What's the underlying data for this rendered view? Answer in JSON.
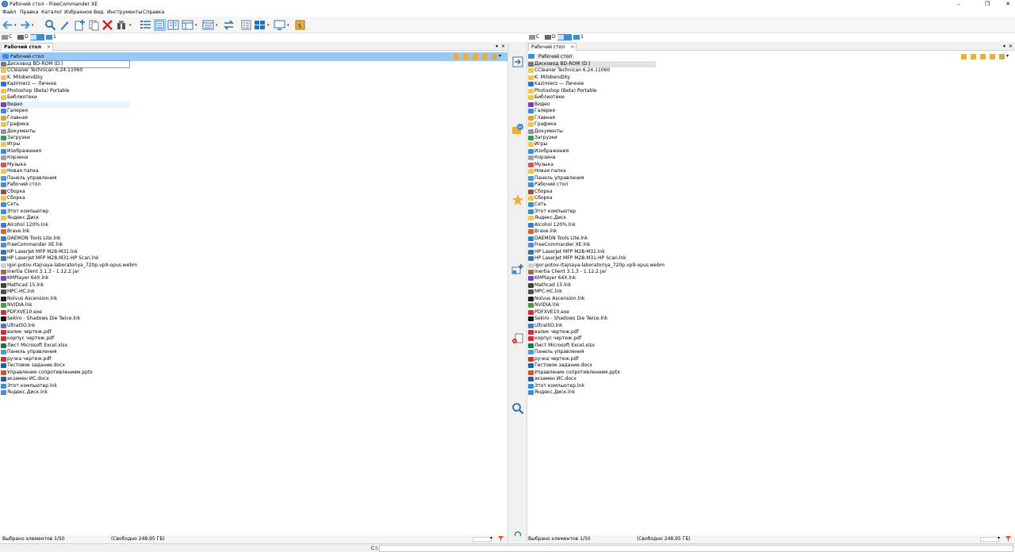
{
  "window": {
    "title": "Рабочий стол - FreeCommander XE"
  },
  "menu": [
    "Файл",
    "Правка",
    "Каталог",
    "Избранное",
    "Вид",
    "Инструменты",
    "Справка"
  ],
  "drives": [
    {
      "label": "C",
      "icon": "drive-icon"
    },
    {
      "label": "D",
      "icon": "optical-drive-icon"
    },
    {
      "label": "",
      "icon": "desktop-drive-icon"
    },
    {
      "label": "1",
      "icon": "network-drive-icon"
    }
  ],
  "left": {
    "tab": "Рабочий стол",
    "path": "Рабочий стол",
    "status_selected": "Выбрано элементов 1/50",
    "status_free": "(Свободно 248,95 ГБ)"
  },
  "right": {
    "tab": "Рабочий стол",
    "path": "Рабочий стол",
    "status_selected": "Выбрано элементов 1/50",
    "status_free": "(Свободно 248,95 ГБ)"
  },
  "files": [
    {
      "name": "Дисковод BD-ROM (D:)",
      "icon": "optical-drive-icon",
      "color": "#777777"
    },
    {
      "name": "CCleaner Technican 6.24.11060",
      "icon": "folder-icon",
      "color": "#f3c44d"
    },
    {
      "name": "K. Milobendzky",
      "icon": "folder-icon",
      "color": "#f3c44d"
    },
    {
      "name": "Kazimierz — Личное",
      "icon": "cloud-icon",
      "color": "#2a6fd6"
    },
    {
      "name": "Photoshop (Beta) Portable",
      "icon": "folder-icon",
      "color": "#f3c44d"
    },
    {
      "name": "Библиотеки",
      "icon": "folder-icon",
      "color": "#f3c44d"
    },
    {
      "name": "Видео",
      "icon": "video-folder-icon",
      "color": "#7a3fc4"
    },
    {
      "name": "Галерея",
      "icon": "gallery-icon",
      "color": "#3b8ed8"
    },
    {
      "name": "Главная",
      "icon": "home-icon",
      "color": "#e0a040"
    },
    {
      "name": "Графика",
      "icon": "folder-icon",
      "color": "#f3c44d"
    },
    {
      "name": "Документы",
      "icon": "documents-icon",
      "color": "#8a96a8"
    },
    {
      "name": "Загрузки",
      "icon": "download-icon",
      "color": "#2aa04a"
    },
    {
      "name": "Игры",
      "icon": "folder-icon",
      "color": "#f3c44d"
    },
    {
      "name": "Изображения",
      "icon": "pictures-icon",
      "color": "#3b8ed8"
    },
    {
      "name": "Корзина",
      "icon": "recycle-bin-icon",
      "color": "#9aa4b0"
    },
    {
      "name": "Музыка",
      "icon": "music-icon",
      "color": "#e05050"
    },
    {
      "name": "Новая папка",
      "icon": "folder-icon",
      "color": "#f3c44d"
    },
    {
      "name": "Панель управления",
      "icon": "control-panel-icon",
      "color": "#4a9ad8"
    },
    {
      "name": "Рабочий стол",
      "icon": "desktop-icon",
      "color": "#3b8ed8"
    },
    {
      "name": "Сборка",
      "icon": "build-icon",
      "color": "#a05030"
    },
    {
      "name": "Сборка",
      "icon": "folder-icon",
      "color": "#f3c44d"
    },
    {
      "name": "Сеть",
      "icon": "network-icon",
      "color": "#3b8ed8"
    },
    {
      "name": "Этот компьютер",
      "icon": "computer-icon",
      "color": "#3b8ed8"
    },
    {
      "name": "Яндекс.Диск",
      "icon": "yandex-disk-icon",
      "color": "#f3c44d"
    },
    {
      "name": "Alcohol 120%.lnk",
      "icon": "alcohol-icon",
      "color": "#3a7ad0"
    },
    {
      "name": "Brave.lnk",
      "icon": "brave-icon",
      "color": "#e06030"
    },
    {
      "name": "DAEMON Tools Lite.lnk",
      "icon": "daemon-tools-icon",
      "color": "#3a7ad0"
    },
    {
      "name": "FreeCommander XE.lnk",
      "icon": "freecommander-icon",
      "color": "#4a8fd8"
    },
    {
      "name": "HP LaserJet MFP M28-M31.lnk",
      "icon": "printer-icon",
      "color": "#3b6fb0"
    },
    {
      "name": "HP LaserJet MFP M28-M31-HP Scan.lnk",
      "icon": "scanner-icon",
      "color": "#3b6fb0"
    },
    {
      "name": "igor-potov-rtajnaya-laboratoriya_720p.vp9-opus.webm",
      "icon": "file-icon",
      "color": "#d0d0d0"
    },
    {
      "name": "Inertia Client 3.1.3 - 1.12.2.jar",
      "icon": "jar-icon",
      "color": "#a07040"
    },
    {
      "name": "KMPlayer 64X.lnk",
      "icon": "kmplayer-icon",
      "color": "#7a3fc4"
    },
    {
      "name": "Mathcad 15.lnk",
      "icon": "mathcad-icon",
      "color": "#404040"
    },
    {
      "name": "MPC-HC.lnk",
      "icon": "mpc-icon",
      "color": "#505050"
    },
    {
      "name": "Nolvus Ascension.lnk",
      "icon": "nolvus-icon",
      "color": "#202020"
    },
    {
      "name": "NVIDIA.lnk",
      "icon": "nvidia-icon",
      "color": "#4a9a3a"
    },
    {
      "name": "PDFXVE10.exe",
      "icon": "pdfxchange-icon",
      "color": "#d03030"
    },
    {
      "name": "Sekiro - Shadows Die Twice.lnk",
      "icon": "sekiro-icon",
      "color": "#181818"
    },
    {
      "name": "UltraISO.lnk",
      "icon": "ultraiso-icon",
      "color": "#4a7ad0"
    },
    {
      "name": "валик чертеж.pdf",
      "icon": "pdf-icon",
      "color": "#d03030"
    },
    {
      "name": "корпус чертеж.pdf",
      "icon": "pdf-icon",
      "color": "#d03030"
    },
    {
      "name": "Лист Microsoft Excel.xlsx",
      "icon": "excel-icon",
      "color": "#1e7a40"
    },
    {
      "name": "Панель управления",
      "icon": "control-panel-icon",
      "color": "#4a9ad8"
    },
    {
      "name": "ручка чертеж.pdf",
      "icon": "pdf-icon",
      "color": "#d03030"
    },
    {
      "name": "Тестовое задание.docx",
      "icon": "word-icon",
      "color": "#2a5aa8"
    },
    {
      "name": "Управление сопротивлением.pptx",
      "icon": "powerpoint-icon",
      "color": "#d05030"
    },
    {
      "name": "экзамен ИС.docx",
      "icon": "word-icon",
      "color": "#2a5aa8"
    },
    {
      "name": "Этот компьютер.lnk",
      "icon": "computer-icon",
      "color": "#3b8ed8"
    },
    {
      "name": "Яндекс.Диск.lnk",
      "icon": "yandex-disk-icon",
      "color": "#3b8ed8"
    }
  ],
  "cmdline": {
    "path": "C:\\",
    "value": ""
  }
}
